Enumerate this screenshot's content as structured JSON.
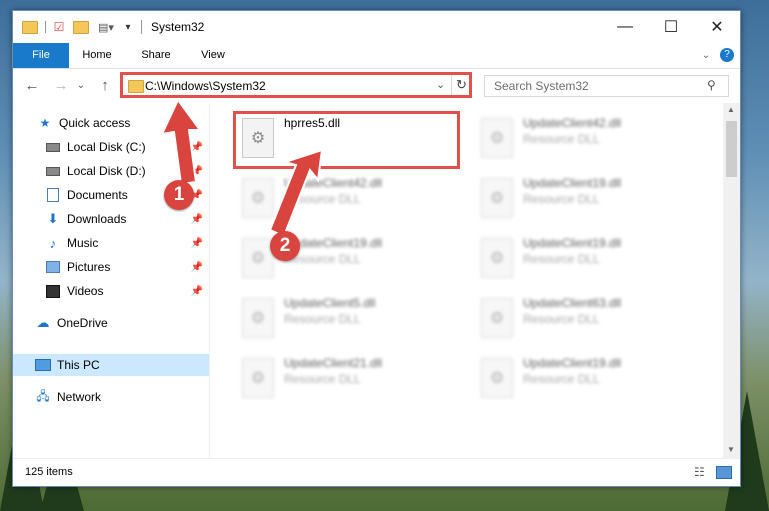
{
  "window": {
    "title": "System32"
  },
  "ribbon": {
    "tabs": [
      "File",
      "Home",
      "Share",
      "View"
    ]
  },
  "address": {
    "path": "C:\\Windows\\System32"
  },
  "search": {
    "placeholder": "Search System32"
  },
  "sidebar": {
    "items": [
      {
        "label": "Quick access",
        "icon": "star-icon"
      },
      {
        "label": "Local Disk (C:)",
        "icon": "drive-icon"
      },
      {
        "label": "Local Disk (D:)",
        "icon": "drive-icon"
      },
      {
        "label": "Documents",
        "icon": "documents-icon"
      },
      {
        "label": "Downloads",
        "icon": "downloads-icon"
      },
      {
        "label": "Music",
        "icon": "music-icon"
      },
      {
        "label": "Pictures",
        "icon": "pictures-icon"
      },
      {
        "label": "Videos",
        "icon": "videos-icon"
      },
      {
        "label": "OneDrive",
        "icon": "cloud-icon"
      },
      {
        "label": "This PC",
        "icon": "computer-icon"
      },
      {
        "label": "Network",
        "icon": "network-icon"
      }
    ]
  },
  "files": [
    {
      "name": "hprres5.dll",
      "type": ""
    },
    {
      "name": "UpdateClient42.dll",
      "type": "Resource DLL"
    },
    {
      "name": "UpdateClient42.dll",
      "type": "Resource DLL"
    },
    {
      "name": "UpdateClient19.dll",
      "type": "Resource DLL"
    },
    {
      "name": "UpdateClient19.dll",
      "type": "Resource DLL"
    },
    {
      "name": "UpdateClient19.dll",
      "type": "Resource DLL"
    },
    {
      "name": "UpdateClient5.dll",
      "type": "Resource DLL"
    },
    {
      "name": "UpdateClient63.dll",
      "type": "Resource DLL"
    },
    {
      "name": "UpdateClient21.dll",
      "type": "Resource DLL"
    },
    {
      "name": "UpdateClient19.dll",
      "type": "Resource DLL"
    }
  ],
  "status": {
    "count": "125 items"
  },
  "annotations": {
    "step1": "1",
    "step2": "2"
  },
  "colors": {
    "accent": "#1979ca",
    "highlight": "#e2504c",
    "selected": "#cce8ff"
  }
}
